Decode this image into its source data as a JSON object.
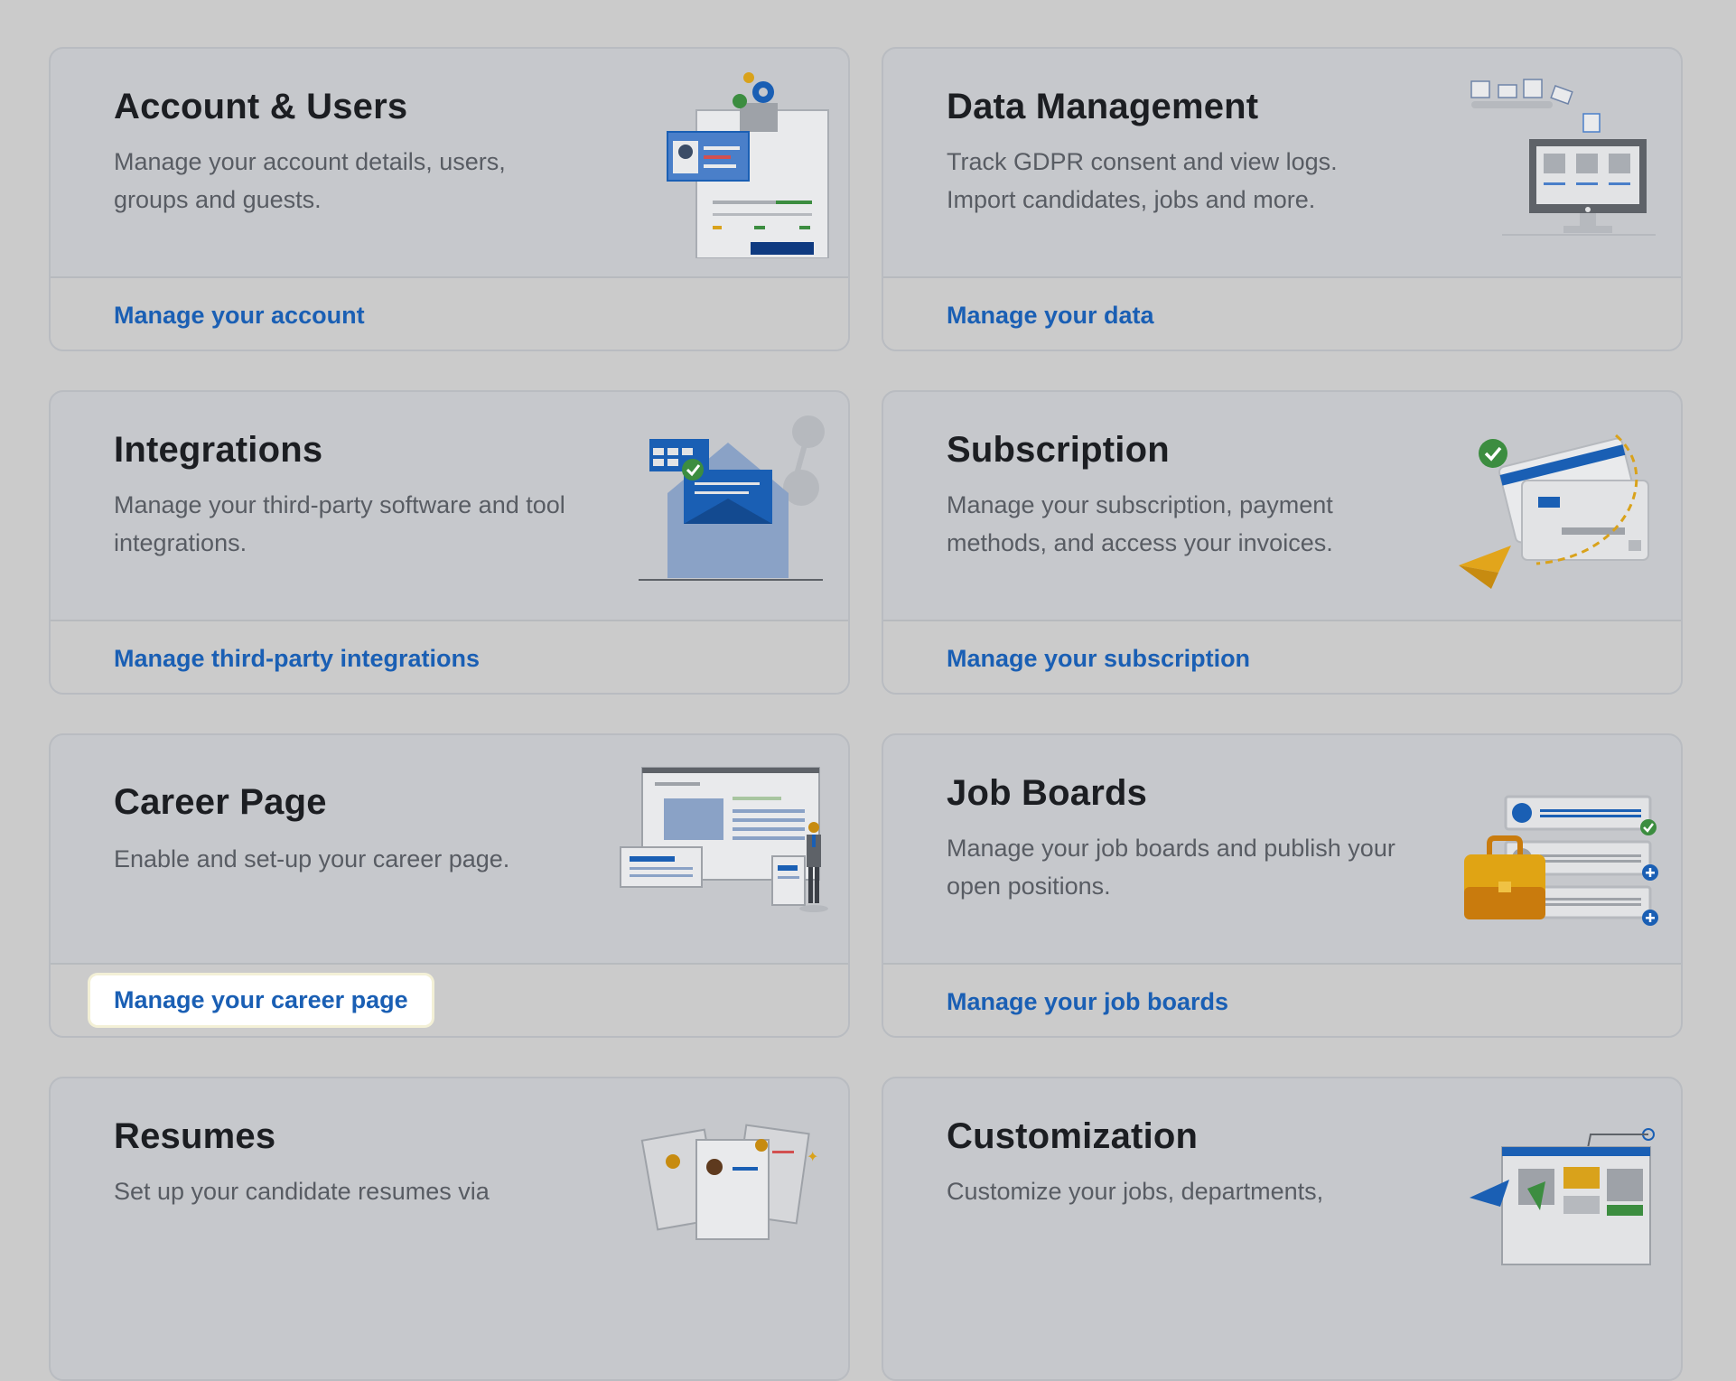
{
  "cards": [
    {
      "id": "account-users",
      "title": "Account & Users",
      "description": "Manage your account details, users, groups and guests.",
      "link": "Manage your account",
      "illustration": "account-illustration"
    },
    {
      "id": "data-management",
      "title": "Data Management",
      "description": "Track GDPR consent and view logs. Import candidates, jobs and more.",
      "link": "Manage your data",
      "illustration": "data-illustration"
    },
    {
      "id": "integrations",
      "title": "Integrations",
      "description": "Manage your third-party software and tool integrations.",
      "link": "Manage third-party integrations",
      "illustration": "integrations-illustration"
    },
    {
      "id": "subscription",
      "title": "Subscription",
      "description": "Manage your subscription, payment methods, and access your invoices.",
      "link": "Manage your subscription",
      "illustration": "subscription-illustration"
    },
    {
      "id": "career-page",
      "title": "Career Page",
      "description": "Enable and set-up your career page.",
      "link": "Manage your career page",
      "illustration": "career-illustration",
      "highlighted": true
    },
    {
      "id": "job-boards",
      "title": "Job Boards",
      "description": "Manage your job boards and publish your open positions.",
      "link": "Manage your job boards",
      "illustration": "jobboards-illustration"
    },
    {
      "id": "resumes",
      "title": "Resumes",
      "description": "Set up your candidate resumes via",
      "illustration": "resumes-illustration"
    },
    {
      "id": "customization",
      "title": "Customization",
      "description": "Customize your jobs, departments,",
      "illustration": "customization-illustration"
    }
  ],
  "colors": {
    "background": "#cbcbcb",
    "card": "#c6c8cc",
    "link": "#1a5fb4",
    "title": "#1c1e22",
    "text": "#585c63"
  }
}
